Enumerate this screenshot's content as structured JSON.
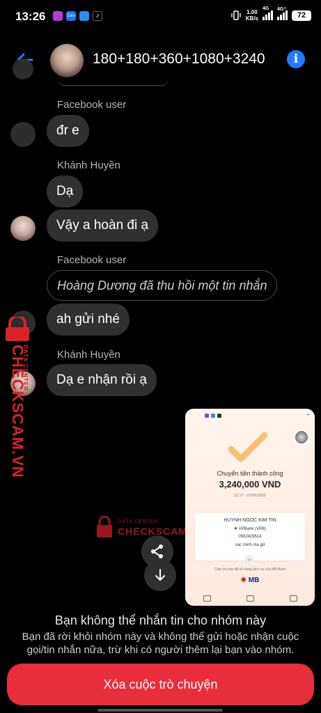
{
  "status_bar": {
    "time": "13:26",
    "speed_value": "1.00",
    "speed_unit": "KB/s",
    "network_1": "4G",
    "network_2": "4G⁺",
    "battery": "72"
  },
  "header": {
    "title": "180+180+360+1080+3240"
  },
  "messages": [
    {
      "sender": "Facebook user",
      "text": "đr e"
    },
    {
      "sender": "Khánh Huyền",
      "text": "Dạ"
    },
    {
      "text": "Vậy a hoàn đi ạ"
    },
    {
      "sender": "Facebook user",
      "text": "Hoàng Dương đã thu hồi một tin nhắn"
    },
    {
      "text": "ah gửi nhé"
    },
    {
      "sender": "Khánh Huyền",
      "text": "Dạ e nhận rồi ạ"
    }
  ],
  "receipt": {
    "status": "Chuyển tiền thành công",
    "amount": "3,240,000 VND",
    "datetime": "12:17 - 27/06/2025",
    "recipient_name": "HUYNH NGOC KIM TIN",
    "bank": "VPBank (VPB)",
    "account": "0562429514",
    "note": "xac minh ma gd",
    "footer": "Cảm ơn bạn đã sử dụng dịch vụ của MB Bank",
    "logo": "MB"
  },
  "watermark": {
    "brand": "CHECKSCAM.VN",
    "subtitle": "DATA CENTER",
    "brand_small": "CHECKSCAM.VN"
  },
  "notice": {
    "title": "Bạn không thể nhắn tin cho nhóm này",
    "body": "Bạn đã rời khỏi nhóm này và không thể gửi hoặc nhận cuộc gọi/tin nhắn nữa, trừ khi có người thêm lại bạn vào nhóm."
  },
  "actions": {
    "delete_label": "Xóa cuộc trò chuyện"
  },
  "colors": {
    "accent": "#1f7bff",
    "danger": "#e82d3b",
    "bubble": "#303030"
  }
}
